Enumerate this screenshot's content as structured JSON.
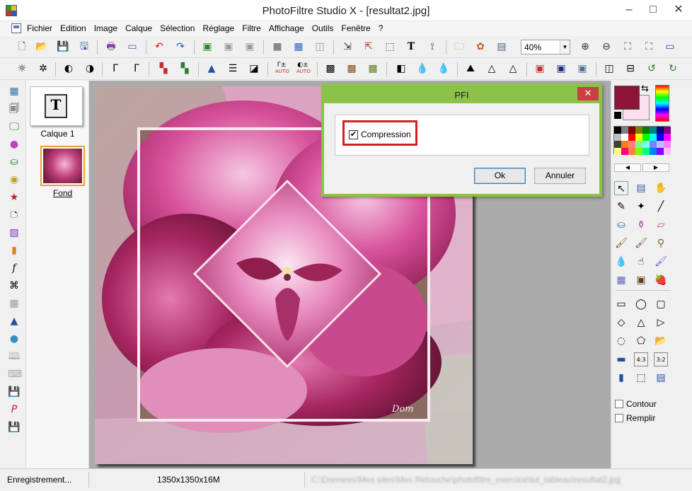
{
  "window": {
    "title": "PhotoFiltre Studio X - [resultat2.jpg]",
    "minimize": "–",
    "maximize": "□",
    "close": "✕"
  },
  "menu": {
    "items": [
      "Fichier",
      "Edition",
      "Image",
      "Calque",
      "Sélection",
      "Réglage",
      "Filtre",
      "Affichage",
      "Outils",
      "Fenêtre",
      "?"
    ],
    "mdi_buttons": [
      "_",
      "❐",
      "x"
    ]
  },
  "toolbar": {
    "zoom_value": "40%",
    "auto_label_1": "AUTO",
    "auto_label_2": "AUTO"
  },
  "layers": [
    {
      "label": "Calque 1",
      "icon_letter": "T"
    },
    {
      "label": "Fond"
    }
  ],
  "image": {
    "signature": "Dom"
  },
  "dialog": {
    "title": "PFI",
    "close": "✕",
    "compression_label": "Compression",
    "compression_checked": true,
    "ok_label": "Ok",
    "cancel_label": "Annuler"
  },
  "colors": {
    "foreground": "#8c1437",
    "background": "#fde0f0",
    "dialog_accent": "#8dc24a",
    "highlight_box": "#d62020"
  },
  "palette": [
    "#000000",
    "#808080",
    "#800000",
    "#808000",
    "#008000",
    "#008080",
    "#000080",
    "#800080",
    "#c0c0c0",
    "#ffffff",
    "#ff0000",
    "#ffff00",
    "#00ff00",
    "#00ffff",
    "#0000ff",
    "#ff00ff",
    "#404040",
    "#ff8000",
    "#ff8080",
    "#80ff80",
    "#80ffff",
    "#8080ff",
    "#c0c0ff",
    "#ff80ff",
    "#ffff80",
    "#ff0080",
    "#ff8040",
    "#80ff00",
    "#00ff80",
    "#0080ff",
    "#8000ff",
    "#ffc0ff"
  ],
  "right_panel": {
    "contour_label": "Contour",
    "remplir_label": "Remplir",
    "ratio_43": "4:3",
    "ratio_32": "3:2"
  },
  "status": {
    "message": "Enregistrement...",
    "dimensions": "1350x1350x16M",
    "path": "C:\\Donnees\\Mes sites\\Mes Retouche\\photofiltre_exercice\\tut_tableau\\resultat2.jpg"
  }
}
